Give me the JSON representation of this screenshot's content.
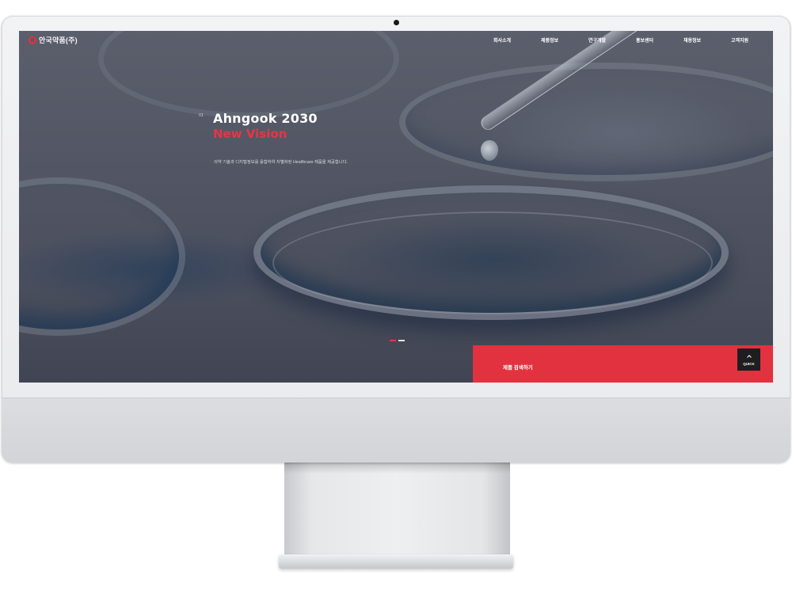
{
  "header": {
    "logo_text": "안국약품(주)",
    "nav": [
      "회사소개",
      "제품정보",
      "연구개발",
      "홍보센터",
      "채용정보",
      "고객지원"
    ]
  },
  "hero": {
    "slide_number": "01",
    "title_line1": "Ahngook 2030",
    "title_line2": "New Vision",
    "description": "의약 기술과 디지털정보를 융합하여 차별화된 Healthcare 제품을 제공합니다.",
    "slide_count": 2,
    "active_slide": 1
  },
  "search_panel": {
    "label": "제품 검색하기",
    "quick_label": "QUICK"
  },
  "colors": {
    "accent": "#e2323f",
    "accent_text": "#ea3443",
    "quick_button": "#1e1e20"
  },
  "icons": [
    "logo-icon",
    "chevron-up-icon"
  ]
}
